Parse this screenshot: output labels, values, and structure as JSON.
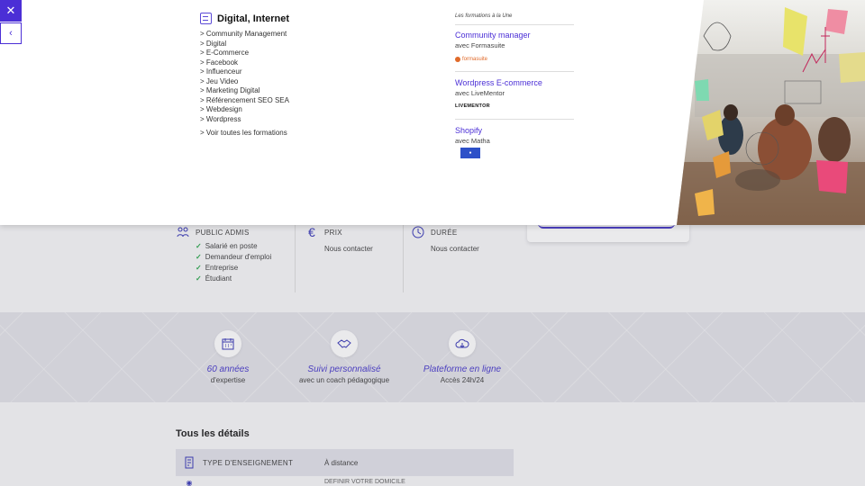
{
  "menu": {
    "close_icon": "close-icon",
    "back_icon": "chevron-left-icon",
    "category": {
      "icon": "laptop-icon",
      "title": "Digital, Internet",
      "items": [
        "Community Management",
        "Digital",
        "E-Commerce",
        "Facebook",
        "Influenceur",
        "Jeu Video",
        "Marketing Digital",
        "Référencement SEO SEA",
        "Webdesign",
        "Wordpress"
      ],
      "see_all": "Voir toutes les formations"
    },
    "featured": {
      "heading": "Les formations à la Une",
      "items": [
        {
          "title": "Community manager",
          "provider": "avec Formasuite",
          "logo": "formasuite"
        },
        {
          "title": "Wordpress E-commerce",
          "provider": "avec LiveMentor",
          "logo": "LIVEMENTOR"
        },
        {
          "title": "Shopify",
          "provider": "avec Matha",
          "logo": "matha-logo"
        }
      ]
    }
  },
  "background": {
    "public": {
      "label": "PUBLIC ADMIS",
      "items": [
        "Salarié en poste",
        "Demandeur d'emploi",
        "Entreprise",
        "Étudiant"
      ]
    },
    "prix": {
      "label": "PRIX",
      "value": "Nous contacter"
    },
    "duree": {
      "label": "DURÉE",
      "value": "Nous contacter"
    },
    "features": [
      {
        "icon": "calendar-icon",
        "title": "60 années",
        "subtitle": "d'expertise"
      },
      {
        "icon": "handshake-icon",
        "title": "Suivi personnalisé",
        "subtitle": "avec un coach pédagogique"
      },
      {
        "icon": "cloud-icon",
        "title": "Plateforme en ligne",
        "subtitle": "Accès 24h/24"
      }
    ],
    "details": {
      "title": "Tous les détails",
      "row_label": "TYPE D'ENSEIGNEMENT",
      "row_value": "À distance",
      "row2_value": "DEFINIR VOTRE DOMICILE"
    }
  },
  "colors": {
    "accent": "#4b2fd6",
    "check": "#2ea84f",
    "link": "#4b2fd6"
  }
}
